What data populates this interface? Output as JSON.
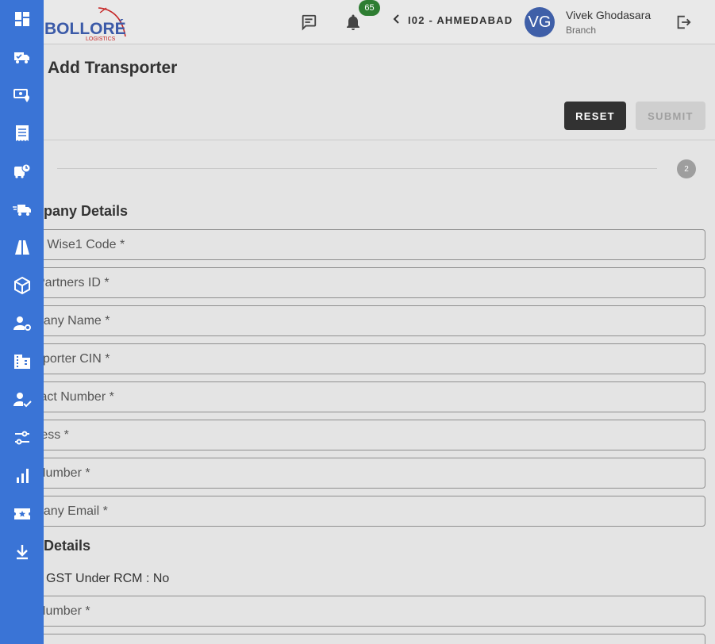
{
  "header": {
    "logo_text": "BOLLORÉ",
    "logo_sub": "LOGISTICS",
    "notification_count": "65",
    "branch_label": "I02 - AHMEDABAD",
    "avatar_initials": "VG",
    "user_name": "Vivek Ghodasara",
    "user_role": "Branch"
  },
  "sidebar": {
    "items": [
      {
        "icon": "dashboard-icon"
      },
      {
        "icon": "truck-check-icon"
      },
      {
        "icon": "money-location-icon"
      },
      {
        "icon": "receipt-icon"
      },
      {
        "icon": "bus-clock-icon"
      },
      {
        "icon": "fast-truck-icon"
      },
      {
        "icon": "road-icon"
      },
      {
        "icon": "package-icon"
      },
      {
        "icon": "user-settings-icon"
      },
      {
        "icon": "business-icon"
      },
      {
        "icon": "user-check-icon"
      },
      {
        "icon": "tune-icon"
      },
      {
        "icon": "analytics-icon"
      },
      {
        "icon": "ticket-star-icon"
      },
      {
        "icon": "download-icon"
      }
    ]
  },
  "page": {
    "title": "Add Transporter",
    "reset_label": "RESET",
    "submit_label": "SUBMIT",
    "step_number": "2"
  },
  "company_section": {
    "title": "pany Details",
    "fields": [
      "o Wise1 Code *",
      "Partners ID *",
      "pany Name *",
      "sporter CIN *",
      "tact Number *",
      "ress *",
      "Number *",
      "pany Email *"
    ]
  },
  "tax_section": {
    "title": "Details",
    "rcm_text": "GST Under RCM : No",
    "fields": [
      "Number *"
    ]
  },
  "colors": {
    "sidebar": "#3a74d6",
    "reset_button": "#323232",
    "badge": "#2e7d32",
    "avatar": "#3f5fa8"
  }
}
